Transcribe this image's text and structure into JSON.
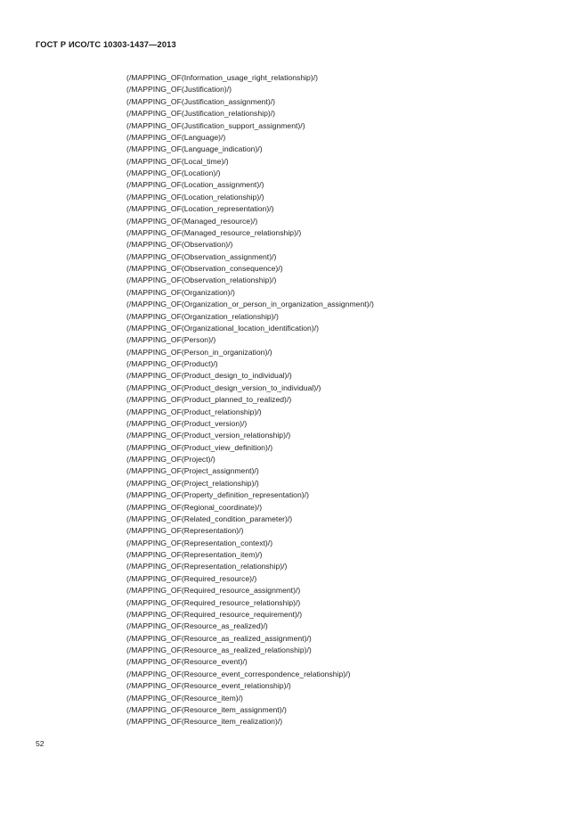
{
  "document": {
    "running_header": "ГОСТ Р ИСО/ТС 10303-1437—2013",
    "page_number": "52",
    "mapping_prefix": "(/MAPPING_OF(",
    "mapping_suffix": ")/)",
    "lines": [
      "(/MAPPING_OF(Information_usage_right_relationship)/)",
      "(/MAPPING_OF(Justification)/)",
      "(/MAPPING_OF(Justification_assignment)/)",
      "(/MAPPING_OF(Justification_relationship)/)",
      "(/MAPPING_OF(Justification_support_assignment)/)",
      "(/MAPPING_OF(Language)/)",
      "(/MAPPING_OF(Language_indication)/)",
      "(/MAPPING_OF(Local_time)/)",
      "(/MAPPING_OF(Location)/)",
      "(/MAPPING_OF(Location_assignment)/)",
      "(/MAPPING_OF(Location_relationship)/)",
      "(/MAPPING_OF(Location_representation)/)",
      "(/MAPPING_OF(Managed_resource)/)",
      "(/MAPPING_OF(Managed_resource_relationship)/)",
      "(/MAPPING_OF(Observation)/)",
      "(/MAPPING_OF(Observation_assignment)/)",
      "(/MAPPING_OF(Observation_consequence)/)",
      "(/MAPPING_OF(Observation_relationship)/)",
      "(/MAPPING_OF(Organization)/)",
      "(/MAPPING_OF(Organization_or_person_in_organization_assignment)/)",
      "(/MAPPING_OF(Organization_relationship)/)",
      "(/MAPPING_OF(Organizational_location_identification)/)",
      "(/MAPPING_OF(Person)/)",
      "(/MAPPING_OF(Person_in_organization)/)",
      "(/MAPPING_OF(Product)/)",
      "(/MAPPING_OF(Product_design_to_individual)/)",
      "(/MAPPING_OF(Product_design_version_to_individual)/)",
      "(/MAPPING_OF(Product_planned_to_realized)/)",
      "(/MAPPING_OF(Product_relationship)/)",
      "(/MAPPING_OF(Product_version)/)",
      "(/MAPPING_OF(Product_version_relationship)/)",
      "(/MAPPING_OF(Product_view_definition)/)",
      "(/MAPPING_OF(Project)/)",
      "(/MAPPING_OF(Project_assignment)/)",
      "(/MAPPING_OF(Project_relationship)/)",
      "(/MAPPING_OF(Property_definition_representation)/)",
      "(/MAPPING_OF(Regional_coordinate)/)",
      "(/MAPPING_OF(Related_condition_parameter)/)",
      "(/MAPPING_OF(Representation)/)",
      "(/MAPPING_OF(Representation_context)/)",
      "(/MAPPING_OF(Representation_item)/)",
      "(/MAPPING_OF(Representation_relationship)/)",
      "(/MAPPING_OF(Required_resource)/)",
      "(/MAPPING_OF(Required_resource_assignment)/)",
      "(/MAPPING_OF(Required_resource_relationship)/)",
      "(/MAPPING_OF(Required_resource_requirement)/)",
      "(/MAPPING_OF(Resource_as_realized)/)",
      "(/MAPPING_OF(Resource_as_realized_assignment)/)",
      "(/MAPPING_OF(Resource_as_realized_relationship)/)",
      "(/MAPPING_OF(Resource_event)/)",
      "(/MAPPING_OF(Resource_event_correspondence_relationship)/)",
      "(/MAPPING_OF(Resource_event_relationship)/)",
      "(/MAPPING_OF(Resource_item)/)",
      "(/MAPPING_OF(Resource_item_assignment)/)",
      "(/MAPPING_OF(Resource_item_realization)/)"
    ]
  }
}
